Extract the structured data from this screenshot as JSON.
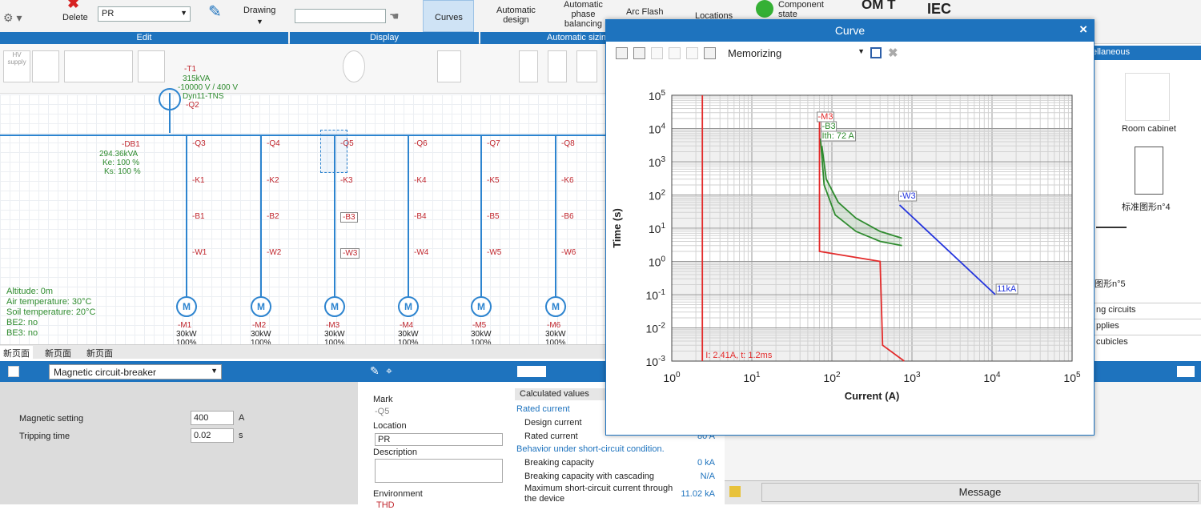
{
  "ribbon": {
    "delete_label": "Delete",
    "pr_value": "PR",
    "drawing_label": "Drawing",
    "curves_label": "Curves",
    "auto_design_l1": "Automatic",
    "auto_design_l2": "design",
    "auto_phase_l1": "Automatic",
    "auto_phase_l2": "phase",
    "auto_phase_l3": "balancing",
    "arc_flash": "Arc Flash",
    "locations": "Locations",
    "component_l1": "Component",
    "component_l2": "state",
    "om": "OM T",
    "iec": "IEC",
    "group_edit": "Edit",
    "group_display": "Display",
    "group_auto": "Automatic sizin"
  },
  "palette": {
    "hv_supply": "HV supply"
  },
  "diagram": {
    "t1": "-T1",
    "t1_power": "315kVA",
    "t1_voltage": "-10000 V / 400 V",
    "t1_type": "Dyn11-TNS",
    "q2": "-Q2",
    "db1": "-DB1",
    "db1_power": "294.36kVA",
    "db1_ke": "Ke: 100 %",
    "db1_ks": "Ks: 100 %",
    "env": [
      "Altitude: 0m",
      "Air temperature: 30°C",
      "Soil temperature: 20°C",
      "BE2: no",
      "BE3: no"
    ],
    "feeders": [
      {
        "q": "-Q3",
        "k": "-K1",
        "b": "-B1",
        "w": "-W1",
        "m": "-M1",
        "p": "30kW",
        "pct": "100%"
      },
      {
        "q": "-Q4",
        "k": "-K2",
        "b": "-B2",
        "w": "-W2",
        "m": "-M2",
        "p": "30kW",
        "pct": "100%"
      },
      {
        "q": "-Q5",
        "k": "-K3",
        "b": "-B3",
        "w": "-W3",
        "m": "-M3",
        "p": "30kW",
        "pct": "100%"
      },
      {
        "q": "-Q6",
        "k": "-K4",
        "b": "-B4",
        "w": "-W4",
        "m": "-M4",
        "p": "30kW",
        "pct": "100%"
      },
      {
        "q": "-Q7",
        "k": "-K5",
        "b": "-B5",
        "w": "-W5",
        "m": "-M5",
        "p": "30kW",
        "pct": "100%"
      },
      {
        "q": "-Q8",
        "k": "-K6",
        "b": "-B6",
        "w": "-W6",
        "m": "-M6",
        "p": "30kW",
        "pct": "100%"
      }
    ]
  },
  "pagetabs": [
    "新页面",
    "新页面",
    "新页面"
  ],
  "bottom": {
    "component_select": "Magnetic circuit-breaker",
    "magnetic_setting_label": "Magnetic setting",
    "magnetic_setting_value": "400",
    "magnetic_setting_unit": "A",
    "tripping_time_label": "Tripping time",
    "tripping_time_value": "0.02",
    "tripping_time_unit": "s",
    "mark_label": "Mark",
    "mark_value": "-Q5",
    "location_label": "Location",
    "location_value": "PR",
    "description_label": "Description",
    "environment_label": "Environment",
    "thd": "THD",
    "calc_header": "Calculated values",
    "rated_current": "Rated current",
    "design_current": "Design current",
    "rated_current_row": "Rated current",
    "rated_current_value": "80 A",
    "behavior": "Behavior under short-circuit condition.",
    "breaking_capacity": "Breaking capacity",
    "breaking_capacity_value": "0 kA",
    "breaking_cascading": "Breaking capacity with cascading",
    "breaking_cascading_value": "N/A",
    "max_sc_l1": "Maximum short-circuit current through",
    "max_sc_l2": "the device",
    "max_sc_value": "11.02 kA"
  },
  "right": {
    "header": "ellaneous",
    "room_cabinet": "Room cabinet",
    "std_shape4": "标准图形n°4",
    "shape5": "图形n°5",
    "list": [
      "ng circuits",
      "pplies",
      "cubicles"
    ],
    "message": "Message"
  },
  "dialog": {
    "title": "Curve",
    "memorizing": "Memorizing",
    "close": "×"
  },
  "colors": {
    "accent": "#1e73be",
    "red_curve": "#e32b2b",
    "green_curve": "#2e8b2e",
    "blue_curve": "#2233dd"
  },
  "chart_data": {
    "type": "line",
    "xlabel": "Current (A)",
    "ylabel": "Time (s)",
    "x_scale": "log",
    "y_scale": "log",
    "xlim": [
      1,
      100000
    ],
    "ylim": [
      0.001,
      100000
    ],
    "x_ticks": [
      "10^0",
      "10^1",
      "10^2",
      "10^3",
      "10^4",
      "10^5"
    ],
    "y_ticks": [
      "10^-3",
      "10^-2",
      "10^-1",
      "10^0",
      "10^1",
      "10^2",
      "10^3",
      "10^4",
      "10^5"
    ],
    "grid": true,
    "series": [
      {
        "name": "-M3",
        "color": "#e32b2b",
        "points": [
          [
            70,
            30000
          ],
          [
            70,
            2
          ],
          [
            400,
            1
          ],
          [
            430,
            0.003
          ],
          [
            800,
            0.001
          ]
        ]
      },
      {
        "name": "-M3",
        "color": "#e32b2b",
        "points": [
          [
            2.41,
            0.001
          ],
          [
            2.41,
            100000
          ]
        ]
      },
      {
        "name": "-B3",
        "color": "#2e8b2e",
        "points": [
          [
            75,
            3000
          ],
          [
            85,
            300
          ],
          [
            120,
            60
          ],
          [
            200,
            20
          ],
          [
            400,
            8
          ],
          [
            750,
            5
          ]
        ]
      },
      {
        "name": "-B3",
        "color": "#2e8b2e",
        "points": [
          [
            72,
            5000
          ],
          [
            80,
            200
          ],
          [
            110,
            25
          ],
          [
            200,
            8
          ],
          [
            400,
            4
          ],
          [
            750,
            3
          ]
        ]
      },
      {
        "name": "-W3",
        "color": "#2233dd",
        "points": [
          [
            700,
            50
          ],
          [
            11000,
            0.1
          ]
        ]
      }
    ],
    "annotations": [
      "-M3",
      "-B3",
      "Ith: 72 A",
      "-W3",
      "11kA",
      "I: 2.41A, t: 1.2ms"
    ]
  }
}
